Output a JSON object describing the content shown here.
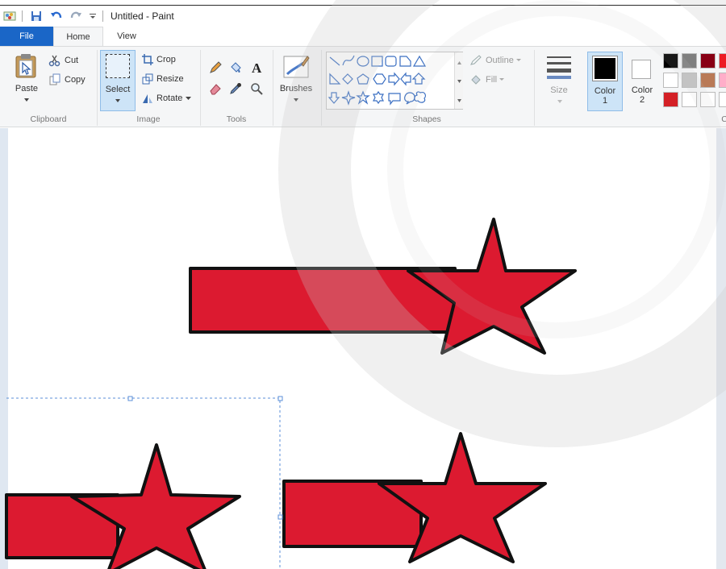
{
  "window": {
    "title": "Untitled - Paint"
  },
  "tabs": {
    "file": "File",
    "home": "Home",
    "view": "View"
  },
  "clipboard": {
    "paste": "Paste",
    "cut": "Cut",
    "copy": "Copy",
    "label": "Clipboard"
  },
  "image": {
    "select": "Select",
    "crop": "Crop",
    "resize": "Resize",
    "rotate": "Rotate",
    "label": "Image"
  },
  "tools": {
    "label": "Tools"
  },
  "brushes": {
    "label": "Brushes"
  },
  "shapes": {
    "outline": "Outline",
    "fill": "Fill",
    "label": "Shapes"
  },
  "size": {
    "label": "Size"
  },
  "color1": {
    "label": "Color",
    "num": "1",
    "color": "#000000"
  },
  "color2": {
    "label": "Color",
    "num": "2",
    "color": "#ffffff"
  },
  "palette": {
    "row1": [
      "#000000",
      "#7f7f7f",
      "#880015",
      "#ed1c24"
    ],
    "row2": [
      "#ffffff",
      "#c3c3c3",
      "#b97a57",
      "#ffaec9"
    ],
    "row3": [
      "#d42026",
      "#ffffff",
      "#ffffff",
      "#ffffff"
    ]
  },
  "drawing": {
    "fill": "#dc1a30",
    "stroke": "#111111"
  }
}
